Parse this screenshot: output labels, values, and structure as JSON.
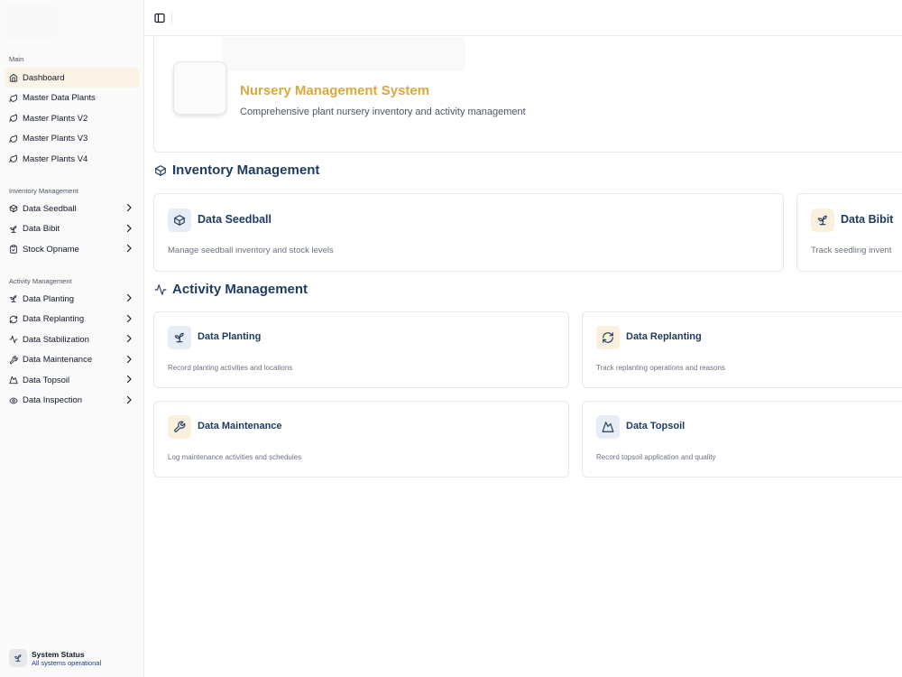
{
  "sidebar": {
    "groups": [
      {
        "label": "Main",
        "items": [
          {
            "label": "Dashboard",
            "icon": "home-icon"
          },
          {
            "label": "Master Data Plants",
            "icon": "leaf-icon"
          },
          {
            "label": "Master Plants V2",
            "icon": "leaf-icon"
          },
          {
            "label": "Master Plants V3",
            "icon": "leaf-icon"
          },
          {
            "label": "Master Plants V4",
            "icon": "leaf-icon"
          }
        ]
      },
      {
        "label": "Inventory Management",
        "items": [
          {
            "label": "Data Seedball",
            "icon": "package-icon"
          },
          {
            "label": "Data Bibit",
            "icon": "sprout-icon"
          },
          {
            "label": "Stock Opname",
            "icon": "clipboard-icon"
          }
        ]
      },
      {
        "label": "Activity Management",
        "items": [
          {
            "label": "Data Planting",
            "icon": "sprout-icon"
          },
          {
            "label": "Data Replanting",
            "icon": "refresh-icon"
          },
          {
            "label": "Data Stabilization",
            "icon": "activity-icon"
          },
          {
            "label": "Data Maintenance",
            "icon": "wrench-icon"
          },
          {
            "label": "Data Topsoil",
            "icon": "mountain-icon"
          },
          {
            "label": "Data Inspection",
            "icon": "eye-icon"
          }
        ]
      }
    ],
    "active_item": "Dashboard",
    "status": {
      "title": "System Status",
      "subtitle": "All systems operational"
    }
  },
  "hero": {
    "title": "Nursery Management System",
    "subtitle": "Comprehensive plant nursery inventory and activity management"
  },
  "inventory_section": {
    "title": "Inventory Management",
    "cards": [
      {
        "title": "Data Seedball",
        "description": "Manage seedball inventory and stock levels",
        "icon": "package-icon"
      },
      {
        "title": "Data Bibit",
        "description": "Track seedling invent",
        "icon": "sprout-icon"
      }
    ]
  },
  "activity_section": {
    "title": "Activity Management",
    "cards": [
      {
        "title": "Data Planting",
        "description": "Record planting activities and locations",
        "icon": "sprout-icon"
      },
      {
        "title": "Data Replanting",
        "description": "Track replanting operations and reasons",
        "icon": "refresh-icon"
      },
      {
        "title": "Data Maintenance",
        "description": "Log maintenance activities and schedules",
        "icon": "wrench-icon"
      },
      {
        "title": "Data Topsoil",
        "description": "Record topsoil application and quality",
        "icon": "mountain-icon"
      }
    ]
  },
  "colors": {
    "accent_gold": "#d9a93b",
    "navy": "#1e3a5f",
    "active_nav_bg": "#fbf4e6"
  }
}
